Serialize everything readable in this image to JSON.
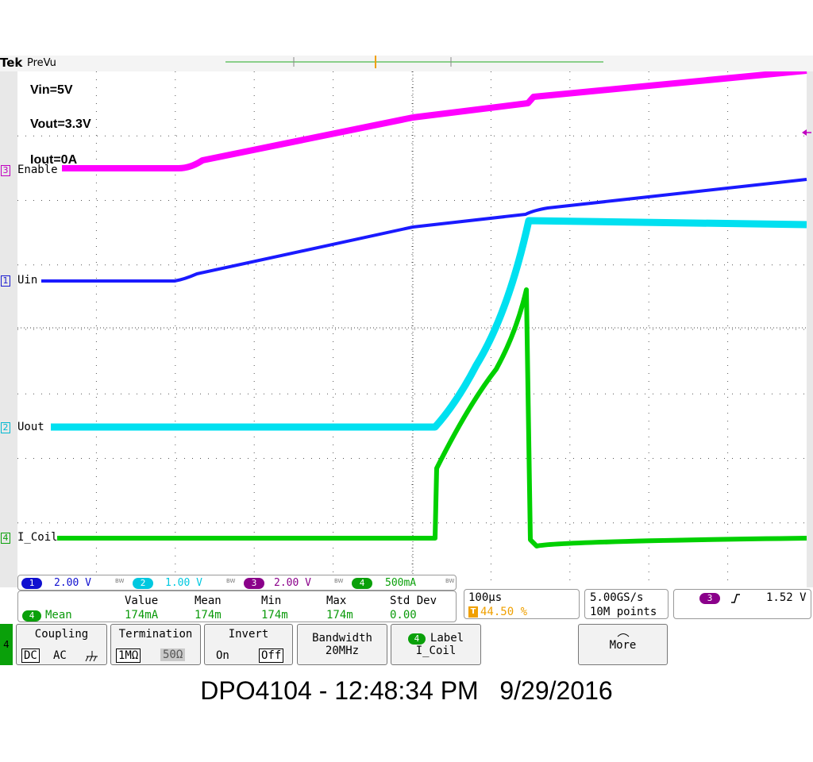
{
  "header": {
    "brand": "Tek",
    "mode": "PreVu"
  },
  "trigger_marker": "T",
  "annotations": [
    "Vin=5V",
    "Vout=3.3V",
    "Iout=0A"
  ],
  "channels": [
    {
      "num": "3",
      "label": "Enable",
      "color": "#ff00ff"
    },
    {
      "num": "1",
      "label": "Uin",
      "color": "#1a1aff"
    },
    {
      "num": "2",
      "label": "Uout",
      "color": "#00e0f0"
    },
    {
      "num": "4",
      "label": "I_Coil",
      "color": "#00d000"
    }
  ],
  "scales": [
    {
      "num": "1",
      "value": "2.00 V",
      "color": "#1010d0"
    },
    {
      "num": "2",
      "value": "1.00 V",
      "color": "#00c8e0"
    },
    {
      "num": "3",
      "value": "2.00 V",
      "color": "#8a008a"
    },
    {
      "num": "4",
      "value": "500mA",
      "color": "#0aa00a"
    }
  ],
  "bw_mark": "BW",
  "measurement": {
    "source": "4",
    "name": "Mean",
    "headers": [
      "Value",
      "Mean",
      "Min",
      "Max",
      "Std Dev"
    ],
    "values": [
      "174mA",
      "174m",
      "174m",
      "174m",
      "0.00"
    ]
  },
  "timebase": {
    "scale": "100µs",
    "trigger_pos": "44.50 %",
    "sample_rate": "5.00GS/s",
    "record": "10M points"
  },
  "trigger": {
    "source": "3",
    "slope": "rising",
    "level": "1.52 V"
  },
  "menu": {
    "channel": "4",
    "coupling": {
      "title": "Coupling",
      "options": [
        "DC",
        "AC"
      ],
      "selected": "DC"
    },
    "termination": {
      "title": "Termination",
      "options": [
        "1MΩ",
        "50Ω"
      ],
      "selected": "1MΩ"
    },
    "invert": {
      "title": "Invert",
      "options": [
        "On",
        "Off"
      ],
      "selected": "Off"
    },
    "bandwidth": {
      "title": "Bandwidth",
      "value": "20MHz"
    },
    "label": {
      "title": "Label",
      "value": "I_Coil"
    },
    "more": "More"
  },
  "footer": "DPO4104 - 12:48:34 PM   9/29/2016"
}
